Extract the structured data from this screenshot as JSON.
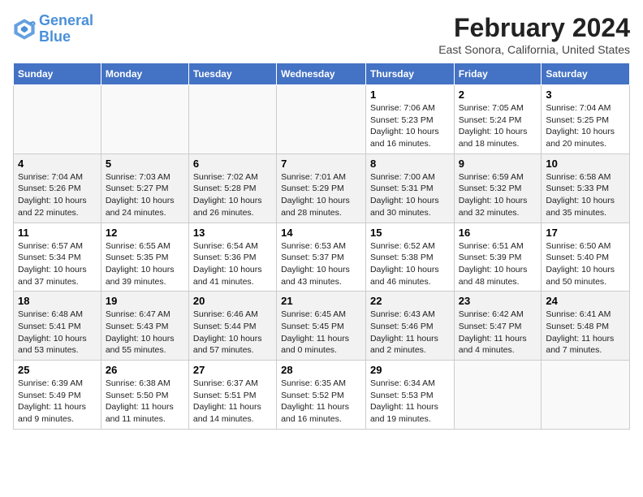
{
  "header": {
    "logo_line1": "General",
    "logo_line2": "Blue",
    "title": "February 2024",
    "subtitle": "East Sonora, California, United States"
  },
  "days_of_week": [
    "Sunday",
    "Monday",
    "Tuesday",
    "Wednesday",
    "Thursday",
    "Friday",
    "Saturday"
  ],
  "weeks": [
    [
      {
        "num": "",
        "info": ""
      },
      {
        "num": "",
        "info": ""
      },
      {
        "num": "",
        "info": ""
      },
      {
        "num": "",
        "info": ""
      },
      {
        "num": "1",
        "info": "Sunrise: 7:06 AM\nSunset: 5:23 PM\nDaylight: 10 hours\nand 16 minutes."
      },
      {
        "num": "2",
        "info": "Sunrise: 7:05 AM\nSunset: 5:24 PM\nDaylight: 10 hours\nand 18 minutes."
      },
      {
        "num": "3",
        "info": "Sunrise: 7:04 AM\nSunset: 5:25 PM\nDaylight: 10 hours\nand 20 minutes."
      }
    ],
    [
      {
        "num": "4",
        "info": "Sunrise: 7:04 AM\nSunset: 5:26 PM\nDaylight: 10 hours\nand 22 minutes."
      },
      {
        "num": "5",
        "info": "Sunrise: 7:03 AM\nSunset: 5:27 PM\nDaylight: 10 hours\nand 24 minutes."
      },
      {
        "num": "6",
        "info": "Sunrise: 7:02 AM\nSunset: 5:28 PM\nDaylight: 10 hours\nand 26 minutes."
      },
      {
        "num": "7",
        "info": "Sunrise: 7:01 AM\nSunset: 5:29 PM\nDaylight: 10 hours\nand 28 minutes."
      },
      {
        "num": "8",
        "info": "Sunrise: 7:00 AM\nSunset: 5:31 PM\nDaylight: 10 hours\nand 30 minutes."
      },
      {
        "num": "9",
        "info": "Sunrise: 6:59 AM\nSunset: 5:32 PM\nDaylight: 10 hours\nand 32 minutes."
      },
      {
        "num": "10",
        "info": "Sunrise: 6:58 AM\nSunset: 5:33 PM\nDaylight: 10 hours\nand 35 minutes."
      }
    ],
    [
      {
        "num": "11",
        "info": "Sunrise: 6:57 AM\nSunset: 5:34 PM\nDaylight: 10 hours\nand 37 minutes."
      },
      {
        "num": "12",
        "info": "Sunrise: 6:55 AM\nSunset: 5:35 PM\nDaylight: 10 hours\nand 39 minutes."
      },
      {
        "num": "13",
        "info": "Sunrise: 6:54 AM\nSunset: 5:36 PM\nDaylight: 10 hours\nand 41 minutes."
      },
      {
        "num": "14",
        "info": "Sunrise: 6:53 AM\nSunset: 5:37 PM\nDaylight: 10 hours\nand 43 minutes."
      },
      {
        "num": "15",
        "info": "Sunrise: 6:52 AM\nSunset: 5:38 PM\nDaylight: 10 hours\nand 46 minutes."
      },
      {
        "num": "16",
        "info": "Sunrise: 6:51 AM\nSunset: 5:39 PM\nDaylight: 10 hours\nand 48 minutes."
      },
      {
        "num": "17",
        "info": "Sunrise: 6:50 AM\nSunset: 5:40 PM\nDaylight: 10 hours\nand 50 minutes."
      }
    ],
    [
      {
        "num": "18",
        "info": "Sunrise: 6:48 AM\nSunset: 5:41 PM\nDaylight: 10 hours\nand 53 minutes."
      },
      {
        "num": "19",
        "info": "Sunrise: 6:47 AM\nSunset: 5:43 PM\nDaylight: 10 hours\nand 55 minutes."
      },
      {
        "num": "20",
        "info": "Sunrise: 6:46 AM\nSunset: 5:44 PM\nDaylight: 10 hours\nand 57 minutes."
      },
      {
        "num": "21",
        "info": "Sunrise: 6:45 AM\nSunset: 5:45 PM\nDaylight: 11 hours\nand 0 minutes."
      },
      {
        "num": "22",
        "info": "Sunrise: 6:43 AM\nSunset: 5:46 PM\nDaylight: 11 hours\nand 2 minutes."
      },
      {
        "num": "23",
        "info": "Sunrise: 6:42 AM\nSunset: 5:47 PM\nDaylight: 11 hours\nand 4 minutes."
      },
      {
        "num": "24",
        "info": "Sunrise: 6:41 AM\nSunset: 5:48 PM\nDaylight: 11 hours\nand 7 minutes."
      }
    ],
    [
      {
        "num": "25",
        "info": "Sunrise: 6:39 AM\nSunset: 5:49 PM\nDaylight: 11 hours\nand 9 minutes."
      },
      {
        "num": "26",
        "info": "Sunrise: 6:38 AM\nSunset: 5:50 PM\nDaylight: 11 hours\nand 11 minutes."
      },
      {
        "num": "27",
        "info": "Sunrise: 6:37 AM\nSunset: 5:51 PM\nDaylight: 11 hours\nand 14 minutes."
      },
      {
        "num": "28",
        "info": "Sunrise: 6:35 AM\nSunset: 5:52 PM\nDaylight: 11 hours\nand 16 minutes."
      },
      {
        "num": "29",
        "info": "Sunrise: 6:34 AM\nSunset: 5:53 PM\nDaylight: 11 hours\nand 19 minutes."
      },
      {
        "num": "",
        "info": ""
      },
      {
        "num": "",
        "info": ""
      }
    ]
  ]
}
